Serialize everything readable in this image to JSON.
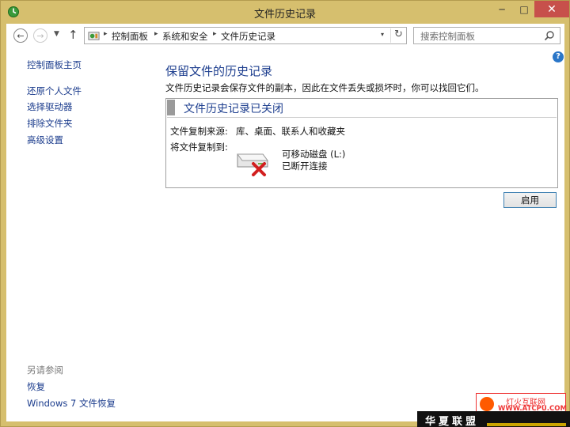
{
  "window": {
    "title": "文件历史记录",
    "minimize": "─",
    "maximize": "□",
    "close": "✕"
  },
  "nav": {
    "back": "←",
    "forward": "→",
    "dropdown": "▼",
    "up": "↑"
  },
  "address": {
    "breadcrumbs": [
      "控制面板",
      "系统和安全",
      "文件历史记录"
    ],
    "separator": "▸",
    "dropdown": "▾",
    "refresh": "↻"
  },
  "search": {
    "placeholder": "搜索控制面板"
  },
  "help": "?",
  "sidebar": {
    "home": "控制面板主页",
    "items": [
      "还原个人文件",
      "选择驱动器",
      "排除文件夹",
      "高级设置"
    ],
    "see_also_label": "另请参阅",
    "see_also": [
      "恢复",
      "Windows 7 文件恢复"
    ]
  },
  "main": {
    "title": "保留文件的历史记录",
    "description": "文件历史记录会保存文件的副本，因此在文件丢失或损坏时，你可以找回它们。",
    "status": {
      "title": "文件历史记录已关闭",
      "source_label": "文件复制来源:",
      "source_value": "库、桌面、联系人和收藏夹",
      "target_label": "将文件复制到:",
      "drive_name": "可移动磁盘 (L:)",
      "drive_status": "已断开连接"
    },
    "enable_button": "启用"
  },
  "watermarks": {
    "top_line": "灯火互联网",
    "url": "WWW.ATCPU.COM",
    "bottom": "华夏联盟"
  }
}
